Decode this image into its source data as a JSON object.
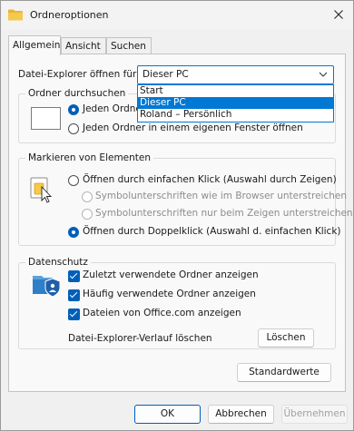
{
  "window": {
    "title": "Ordneroptionen",
    "close_icon": "close-icon"
  },
  "tabs": [
    {
      "label": "Allgemein",
      "active": true
    },
    {
      "label": "Ansicht",
      "active": false
    },
    {
      "label": "Suchen",
      "active": false
    }
  ],
  "explorer_open": {
    "label": "Datei-Explorer öffnen für:",
    "selected": "Dieser PC",
    "options": [
      "Start",
      "Dieser PC",
      "Roland – Persönlich"
    ]
  },
  "browse_folders": {
    "title": "Ordner durchsuchen",
    "options": [
      {
        "label": "Jeden Ordner",
        "checked": true
      },
      {
        "label": "Jeden Ordner in einem eigenen Fenster öffnen",
        "checked": false
      }
    ]
  },
  "click_items": {
    "title": "Markieren von Elementen",
    "options": [
      {
        "label": "Öffnen durch einfachen Klick (Auswahl durch Zeigen)",
        "checked": false,
        "disabled": false
      },
      {
        "label": "Symbolunterschriften wie im Browser unterstreichen",
        "checked": false,
        "disabled": true
      },
      {
        "label": "Symbolunterschriften nur beim Zeigen unterstreichen",
        "checked": false,
        "disabled": true
      },
      {
        "label": "Öffnen durch Doppelklick (Auswahl d. einfachen Klick)",
        "checked": true,
        "disabled": false
      }
    ]
  },
  "privacy": {
    "title": "Datenschutz",
    "checkboxes": [
      {
        "label": "Zuletzt verwendete Ordner anzeigen",
        "checked": true
      },
      {
        "label": "Häufig verwendete Ordner anzeigen",
        "checked": true
      },
      {
        "label": "Dateien von Office.com anzeigen",
        "checked": true
      }
    ],
    "clear_label": "Datei-Explorer-Verlauf löschen",
    "clear_button": "Löschen"
  },
  "defaults_button": "Standardwerte",
  "buttons": {
    "ok": "OK",
    "cancel": "Abbrechen",
    "apply": "Übernehmen"
  },
  "colors": {
    "accent": "#005fb8",
    "selection": "#0078d4"
  }
}
